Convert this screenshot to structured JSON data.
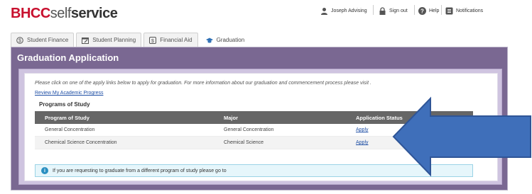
{
  "header": {
    "logo_bhcc": "BHCC",
    "logo_self": "self",
    "logo_service": "service",
    "user_label": "Joseph Advising",
    "signout_label": "Sign out",
    "help_label": "Help",
    "notifications_label": "Notifications"
  },
  "tabs": [
    {
      "label": "Student Finance",
      "icon": "dollar-circle-icon"
    },
    {
      "label": "Student Planning",
      "icon": "calendar-icon"
    },
    {
      "label": "Financial Aid",
      "icon": "dollar-square-icon"
    },
    {
      "label": "Graduation",
      "icon": "graduation-cap-icon"
    }
  ],
  "page": {
    "title": "Graduation Application",
    "intro": "Please click on one of the apply links below to apply for graduation. For more information about our graduation and commencement process please visit .",
    "progress_link": "Review My Academic Progress",
    "section_title": "Programs of Study"
  },
  "table": {
    "headers": [
      "Program of Study",
      "Major",
      "Application Status"
    ],
    "rows": [
      {
        "program": "General Concentration",
        "major": "General Concentration",
        "status": "Apply"
      },
      {
        "program": "Chemical Science Concentration",
        "major": "Chemical Science",
        "status": "Apply"
      }
    ]
  },
  "note": {
    "text": "If you are requesting to graduate from a different program of study please go to"
  },
  "colors": {
    "brand_red": "#c8102e",
    "panel_purple": "#7a6892",
    "inner_lavender": "#cfc4e0",
    "table_header": "#666666",
    "arrow_blue": "#3f6fba"
  }
}
